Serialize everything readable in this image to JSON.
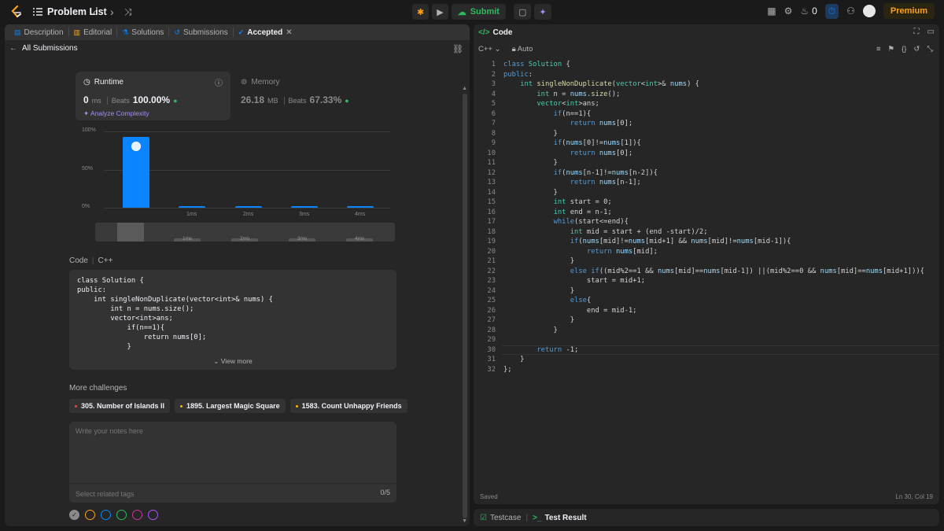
{
  "topbar": {
    "title": "Problem List",
    "submit_label": "Submit",
    "streak_count": "0",
    "premium_label": "Premium"
  },
  "left_tabs": [
    {
      "label": "Description"
    },
    {
      "label": "Editorial"
    },
    {
      "label": "Solutions"
    },
    {
      "label": "Submissions"
    },
    {
      "label": "Accepted"
    }
  ],
  "submission": {
    "back_label": "All Submissions",
    "runtime": {
      "label": "Runtime",
      "value": "0",
      "unit": "ms",
      "beats_label": "Beats",
      "beats_value": "100.00%",
      "analyze_label": "Analyze Complexity"
    },
    "memory": {
      "label": "Memory",
      "value": "26.18",
      "unit": "MB",
      "beats_label": "Beats",
      "beats_value": "67.33%"
    }
  },
  "chart_data": {
    "type": "bar",
    "categories": [
      "0ms",
      "1ms",
      "2ms",
      "3ms",
      "4ms"
    ],
    "values": [
      93,
      2,
      2,
      2,
      2
    ],
    "ylim": [
      0,
      100
    ],
    "y_ticks": [
      "100%",
      "50%",
      "0%"
    ],
    "x_tick_labels": [
      "",
      "1ms",
      "2ms",
      "3ms",
      "4ms"
    ],
    "minimap_labels": [
      "1ms",
      "2ms",
      "3ms",
      "4ms"
    ],
    "bar_color": "#0a84ff"
  },
  "code_section": {
    "label": "Code",
    "language": "C++",
    "preview": "class Solution {\npublic:\n    int singleNonDuplicate(vector<int>& nums) {\n        int n = nums.size();\n        vector<int>ans;\n            if(n==1){\n                return nums[0];\n            }",
    "view_more": "View more"
  },
  "more_challenges": {
    "title": "More challenges",
    "items": [
      {
        "label": "305. Number of Islands II",
        "color": "#ef4743"
      },
      {
        "label": "1895. Largest Magic Square",
        "color": "#ffb800"
      },
      {
        "label": "1583. Count Unhappy Friends",
        "color": "#ffb800"
      }
    ]
  },
  "notes": {
    "placeholder": "Write your notes here",
    "tags_placeholder": "Select related tags",
    "tag_count": "0/5",
    "colors": [
      "#8a8a8a",
      "#ffa116",
      "#0a84ff",
      "#2cbb5d",
      "#cc3399",
      "#a855f7"
    ]
  },
  "code_panel": {
    "title": "Code",
    "language": "C++",
    "mode": "Auto",
    "status": "Saved",
    "cursor": "Ln 30, Col 19"
  },
  "code_lines": [
    "class Solution {",
    "public:",
    "    int singleNonDuplicate(vector<int>& nums) {",
    "        int n = nums.size();",
    "        vector<int>ans;",
    "            if(n==1){",
    "                return nums[0];",
    "            }",
    "            if(nums[0]!=nums[1]){",
    "                return nums[0];",
    "            }",
    "            if(nums[n-1]!=nums[n-2]){",
    "                return nums[n-1];",
    "            }",
    "            int start = 0;",
    "            int end = n-1;",
    "            while(start<=end){",
    "                int mid = start + (end -start)/2;",
    "                if(nums[mid]!=nums[mid+1] && nums[mid]!=nums[mid-1]){",
    "                    return nums[mid];",
    "                }",
    "                else if((mid%2==1 && nums[mid]==nums[mid-1]) ||(mid%2==0 && nums[mid]==nums[mid+1])){",
    "                    start = mid+1;",
    "                }",
    "                else{",
    "                    end = mid-1;",
    "                }",
    "            }",
    "",
    "        return -1;",
    "    }",
    "};"
  ],
  "bottom_tabs": [
    {
      "label": "Testcase"
    },
    {
      "label": "Test Result"
    }
  ]
}
